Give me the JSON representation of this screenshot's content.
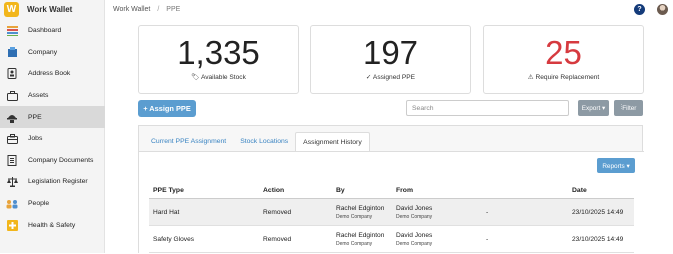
{
  "app": {
    "name": "Work Wallet",
    "logo_letter": "W"
  },
  "breadcrumb": {
    "root": "Work Wallet",
    "separator": "/",
    "current": "PPE"
  },
  "sidebar": {
    "items": [
      {
        "label": "Dashboard",
        "icon": "dashboard-icon",
        "active": false
      },
      {
        "label": "Company",
        "icon": "company-icon",
        "active": false
      },
      {
        "label": "Address Book",
        "icon": "address-book-icon",
        "active": false
      },
      {
        "label": "Assets",
        "icon": "assets-icon",
        "active": false
      },
      {
        "label": "PPE",
        "icon": "ppe-icon",
        "active": true
      },
      {
        "label": "Jobs",
        "icon": "jobs-icon",
        "active": false
      },
      {
        "label": "Company Documents",
        "icon": "documents-icon",
        "active": false
      },
      {
        "label": "Legislation Register",
        "icon": "legislation-icon",
        "active": false
      },
      {
        "label": "People",
        "icon": "people-icon",
        "active": false
      },
      {
        "label": "Health & Safety",
        "icon": "health-safety-icon",
        "active": false
      }
    ]
  },
  "stats": [
    {
      "value": "1,335",
      "label": "Available Stock",
      "icon": "tag-icon",
      "glyph": "🏷",
      "color": "#222222"
    },
    {
      "value": "197",
      "label": "Assigned PPE",
      "icon": "check-icon",
      "glyph": "✓",
      "color": "#222222"
    },
    {
      "value": "25",
      "label": "Require Replacement",
      "icon": "warning-icon",
      "glyph": "⚠",
      "color": "#d63a3f"
    }
  ],
  "toolbar": {
    "assign_label": "+ Assign PPE",
    "search_placeholder": "Search",
    "export_label": "Export ▾",
    "filter_label": "Filter"
  },
  "tabs": [
    {
      "label": "Current PPE Assignment",
      "active": false
    },
    {
      "label": "Stock Locations",
      "active": false
    },
    {
      "label": "Assignment History",
      "active": true
    }
  ],
  "reports_label": "Reports ▾",
  "table": {
    "headers": [
      "PPE Type",
      "Action",
      "By",
      "From",
      "Date"
    ],
    "rows": [
      {
        "type": "Hard Hat",
        "action": "Removed",
        "by_name": "Rachel Edginton",
        "by_company": "Demo Company",
        "from_name": "David Jones",
        "from_company": "Demo Company",
        "to": "-",
        "date": "23/10/2025 14:49"
      },
      {
        "type": "Safety Gloves",
        "action": "Removed",
        "by_name": "Rachel Edginton",
        "by_company": "Demo Company",
        "from_name": "David Jones",
        "from_company": "Demo Company",
        "to": "-",
        "date": "23/10/2025 14:49"
      }
    ]
  },
  "colors": {
    "accent": "#5b9dd0",
    "danger": "#d63a3f",
    "muted_button": "#8d9aa4",
    "help": "#143b7a"
  }
}
